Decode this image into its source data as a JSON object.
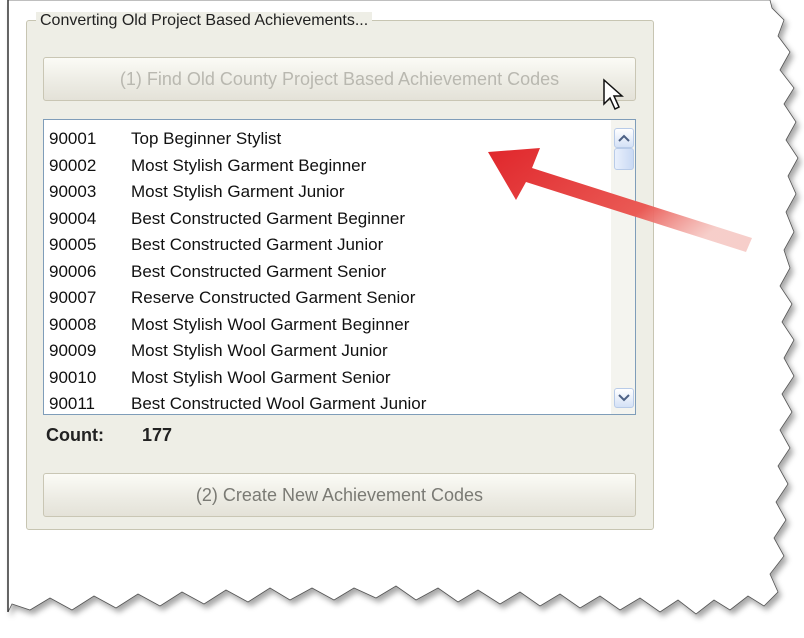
{
  "group": {
    "title": "Converting Old Project Based Achievements..."
  },
  "buttons": {
    "find_label": "(1)  Find Old County Project Based Achievement Codes",
    "create_label": "(2)  Create New Achievement Codes"
  },
  "list": {
    "rows": [
      {
        "code": "90001",
        "name": "Top Beginner Stylist"
      },
      {
        "code": "90002",
        "name": "Most Stylish Garment Beginner"
      },
      {
        "code": "90003",
        "name": "Most Stylish Garment Junior"
      },
      {
        "code": "90004",
        "name": "Best Constructed Garment Beginner"
      },
      {
        "code": "90005",
        "name": "Best Constructed Garment Junior"
      },
      {
        "code": "90006",
        "name": "Best Constructed Garment Senior"
      },
      {
        "code": "90007",
        "name": "Reserve Constructed Garment Senior"
      },
      {
        "code": "90008",
        "name": "Most Stylish Wool Garment Beginner"
      },
      {
        "code": "90009",
        "name": "Most Stylish Wool Garment Junior"
      },
      {
        "code": "90010",
        "name": "Most Stylish Wool Garment Senior"
      },
      {
        "code": "90011",
        "name": "Best Constructed Wool Garment Junior"
      }
    ]
  },
  "count": {
    "label": "Count:",
    "value": "177"
  },
  "icons": {
    "scroll_up": "chevron-up-icon",
    "scroll_down": "chevron-down-icon",
    "cursor": "mouse-pointer-icon",
    "annotation": "red-arrow-icon"
  },
  "colors": {
    "annotation_arrow": "#e0262b",
    "list_border": "#7f9db9"
  }
}
